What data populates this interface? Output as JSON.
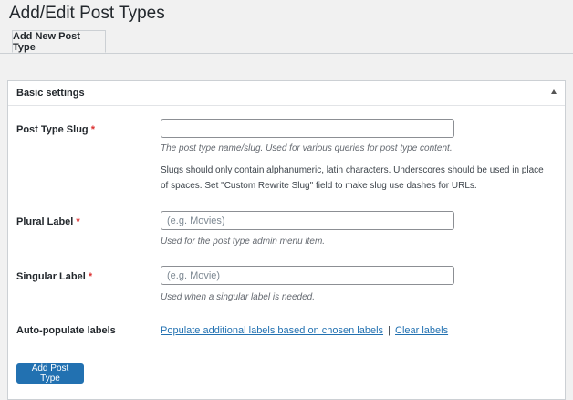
{
  "page": {
    "title": "Add/Edit Post Types"
  },
  "tabs": [
    {
      "label": "Add New Post Type"
    }
  ],
  "postbox": {
    "title": "Basic settings"
  },
  "fields": {
    "slug": {
      "label": "Post Type Slug",
      "required_mark": "*",
      "value": "",
      "placeholder": "",
      "help": "The post type name/slug. Used for various queries for post type content.",
      "note": "Slugs should only contain alphanumeric, latin characters. Underscores should be used in place of spaces. Set \"Custom Rewrite Slug\" field to make slug use dashes for URLs."
    },
    "plural": {
      "label": "Plural Label",
      "required_mark": "*",
      "value": "",
      "placeholder": "(e.g. Movies)",
      "help": "Used for the post type admin menu item."
    },
    "singular": {
      "label": "Singular Label",
      "required_mark": "*",
      "value": "",
      "placeholder": "(e.g. Movie)",
      "help": "Used when a singular label is needed."
    },
    "autopopulate": {
      "label": "Auto-populate labels",
      "populate_link": "Populate additional labels based on chosen labels",
      "separator": "|",
      "clear_link": "Clear labels"
    }
  },
  "actions": {
    "submit_label": "Add Post Type"
  },
  "colors": {
    "primary": "#2271b1",
    "required": "#dc3232",
    "background": "#f1f1f1"
  }
}
